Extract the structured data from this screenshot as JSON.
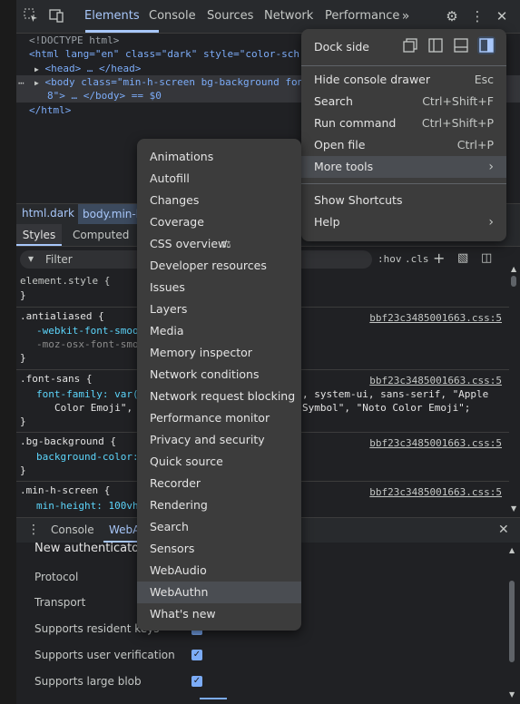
{
  "toolbar": {
    "tabs": [
      "Elements",
      "Console",
      "Sources",
      "Network",
      "Performance"
    ],
    "overflow_icon": "chevron-double-right-icon"
  },
  "elements": {
    "doctype": "<!DOCTYPE html>",
    "html_open": "<html lang=\"en\" class=\"dark\" style=\"color-sch",
    "head_line": "<head> … </head>",
    "body_line1": "<body class=\"min-h-screen bg-background fon",
    "body_line2": "8\"> … </body> == $0",
    "html_close": "</html>"
  },
  "breadcrumbs": [
    "html.dark",
    "body.min-h-"
  ],
  "styles": {
    "tabs": [
      "Styles",
      "Computed"
    ],
    "filter_placeholder": "Filter",
    "hov": ":hov",
    "cls": ".cls",
    "rules": [
      {
        "selector": "element.style {",
        "close": "}"
      },
      {
        "selector": ".antialiased {",
        "link": "bbf23c3485001663.css:5",
        "l1": "-webkit-font-smoo",
        "l2": "-moz-osx-font-smo",
        "close": "}"
      },
      {
        "selector": ".font-sans {",
        "link": "bbf23c3485001663.css:5",
        "l1": "font-family: var(",
        "l1b": ", system-ui, sans-serif, \"Apple",
        "l2": "Color Emoji\",",
        "l2b": "Symbol\", \"Noto Color Emoji\";",
        "close": "}"
      },
      {
        "selector": ".bg-background {",
        "link": "bbf23c3485001663.css:5",
        "l1": "background-color:",
        "close": "}"
      },
      {
        "selector": ".min-h-screen {",
        "link": "bbf23c3485001663.css:5",
        "l1": "min-height: 100vh"
      }
    ]
  },
  "drawer": {
    "tabs": [
      "Console",
      "WebA"
    ],
    "heading": "New authenticator",
    "rows": [
      "Protocol",
      "Transport",
      "Supports resident keys",
      "Supports user verification",
      "Supports large blob"
    ]
  },
  "main_menu": {
    "dock_side": "Dock side",
    "items": [
      {
        "label": "Hide console drawer",
        "shortcut": "Esc"
      },
      {
        "label": "Search",
        "shortcut": "Ctrl+Shift+F"
      },
      {
        "label": "Run command",
        "shortcut": "Ctrl+Shift+P"
      },
      {
        "label": "Open file",
        "shortcut": "Ctrl+P"
      },
      {
        "label": "More tools",
        "shortcut": ""
      },
      {
        "label": "Show Shortcuts",
        "shortcut": ""
      },
      {
        "label": "Help",
        "shortcut": ""
      }
    ]
  },
  "more_tools": [
    "Animations",
    "Autofill",
    "Changes",
    "Coverage",
    "CSS overview",
    "Developer resources",
    "Issues",
    "Layers",
    "Media",
    "Memory inspector",
    "Network conditions",
    "Network request blocking",
    "Performance monitor",
    "Privacy and security",
    "Quick source",
    "Recorder",
    "Rendering",
    "Search",
    "Sensors",
    "WebAudio",
    "WebAuthn",
    "What's new"
  ],
  "colors": {
    "accent": "#a8c7fa",
    "menu_bg": "#3c3c3c",
    "panel_bg": "#202124"
  }
}
